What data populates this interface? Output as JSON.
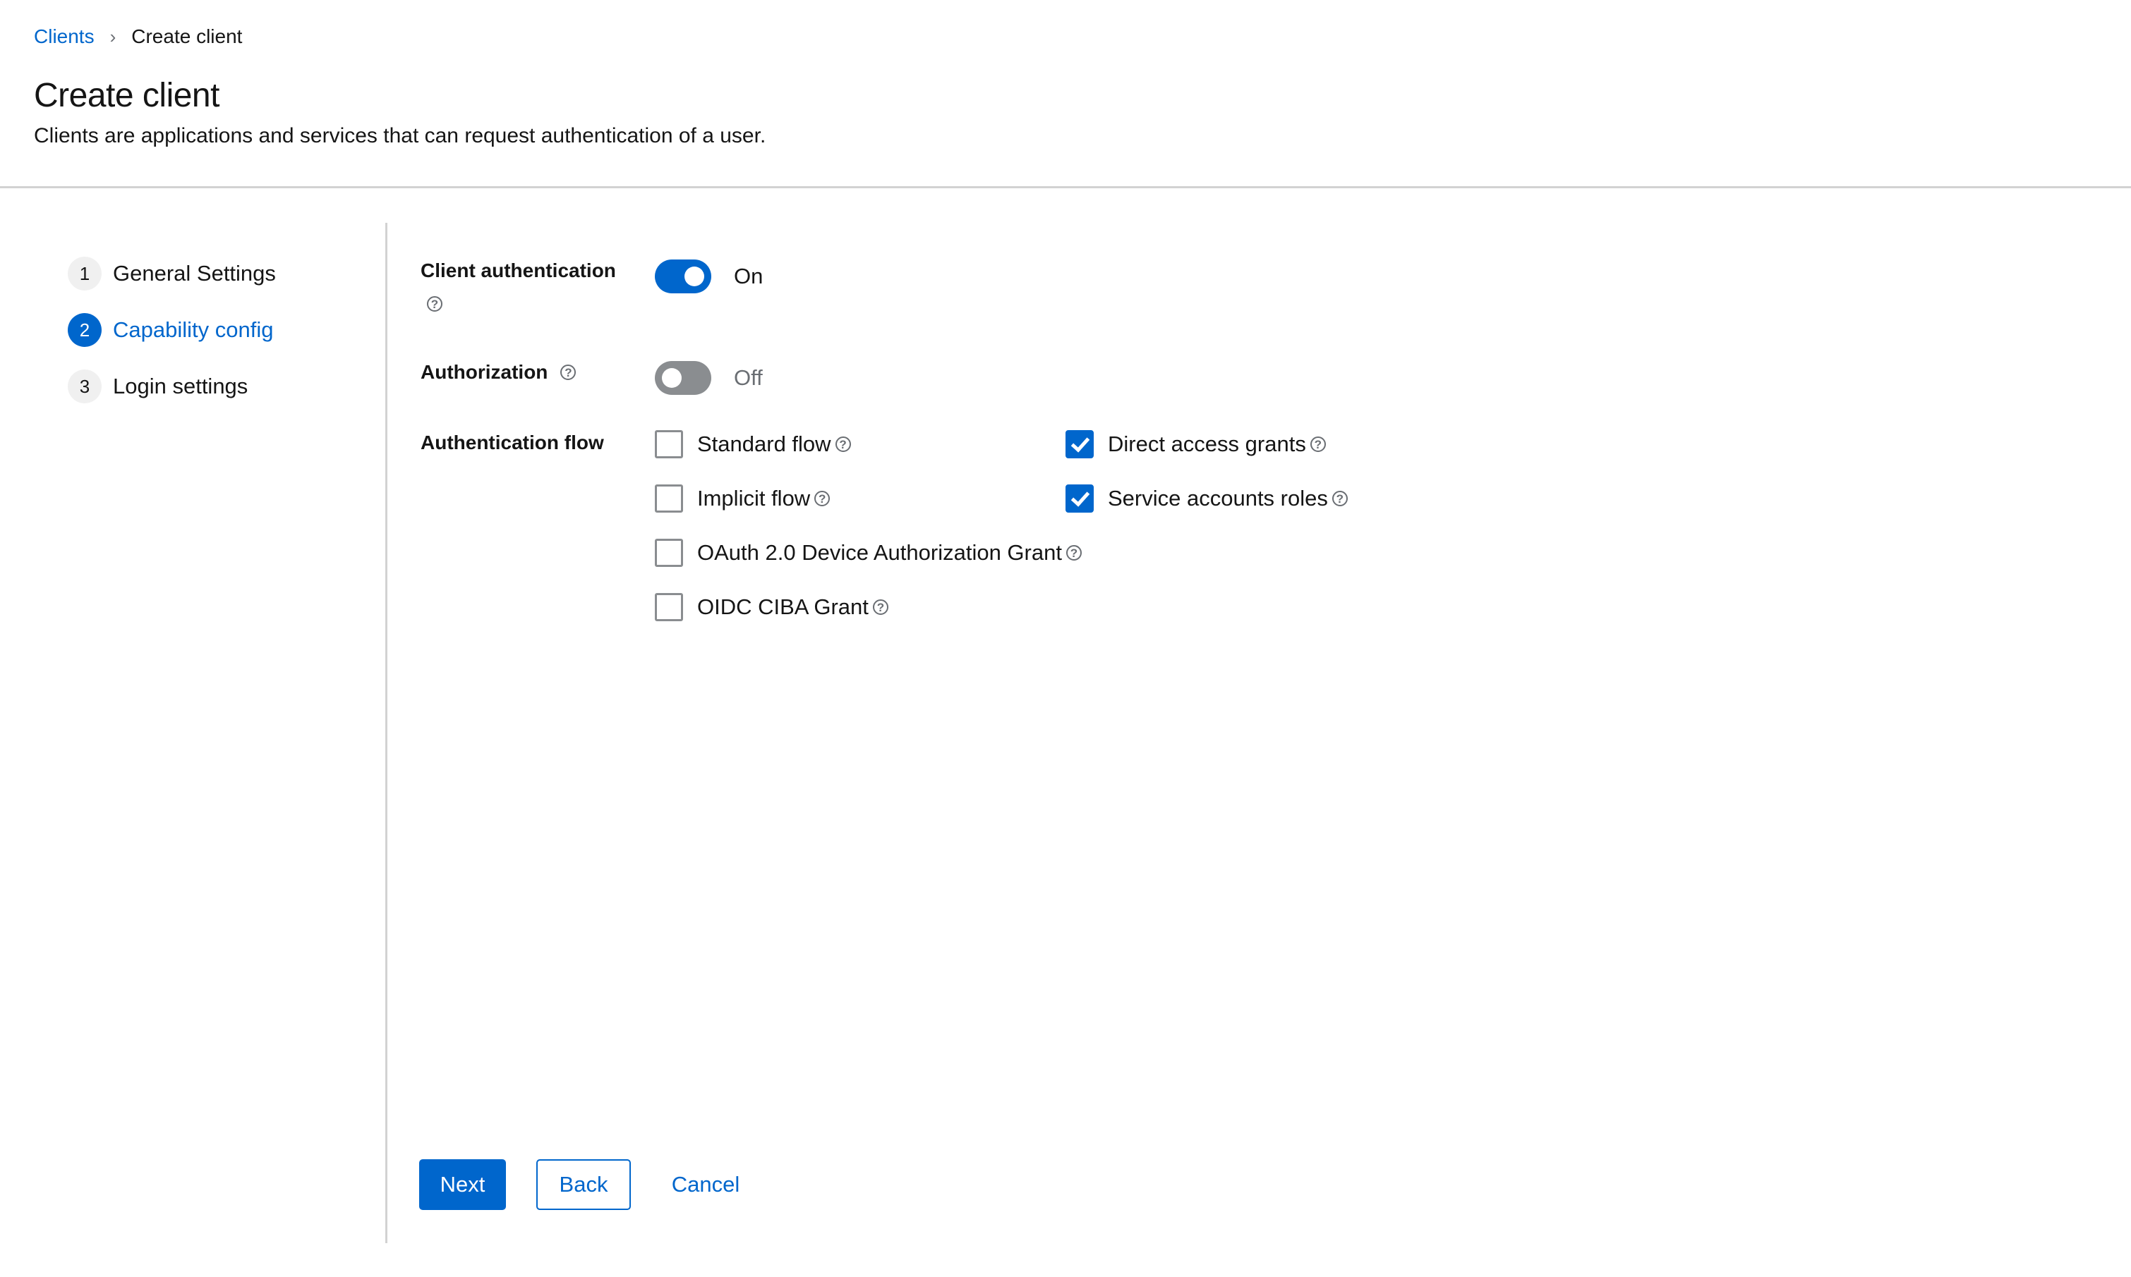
{
  "breadcrumb": {
    "items": [
      {
        "label": "Clients",
        "link": true
      },
      {
        "label": "Create client",
        "link": false
      }
    ],
    "separator_icon": "chevron-right-icon"
  },
  "header": {
    "title": "Create client",
    "subtitle": "Clients are applications and services that can request authentication of a user."
  },
  "wizard": {
    "steps": [
      {
        "number": "1",
        "label": "General Settings",
        "current": false
      },
      {
        "number": "2",
        "label": "Capability config",
        "current": true
      },
      {
        "number": "3",
        "label": "Login settings",
        "current": false
      }
    ]
  },
  "form": {
    "client_authentication": {
      "label": "Client authentication",
      "state": "On",
      "enabled": true,
      "help_icon": "help-icon"
    },
    "authorization": {
      "label": "Authorization",
      "state": "Off",
      "enabled": false,
      "help_icon": "help-icon"
    },
    "authentication_flow": {
      "label": "Authentication flow",
      "options": [
        {
          "label": "Standard flow",
          "checked": false
        },
        {
          "label": "Direct access grants",
          "checked": true
        },
        {
          "label": "Implicit flow",
          "checked": false
        },
        {
          "label": "Service accounts roles",
          "checked": true
        },
        {
          "label": "OAuth 2.0 Device Authorization Grant",
          "checked": false
        },
        {
          "label": "OIDC CIBA Grant",
          "checked": false
        }
      ]
    }
  },
  "actions": {
    "next": "Next",
    "back": "Back",
    "cancel": "Cancel"
  },
  "colors": {
    "accent": "#0066cc",
    "toggle_off": "#8a8d90",
    "divider": "#d2d2d2",
    "text": "#151515",
    "muted": "#6a6e73"
  }
}
